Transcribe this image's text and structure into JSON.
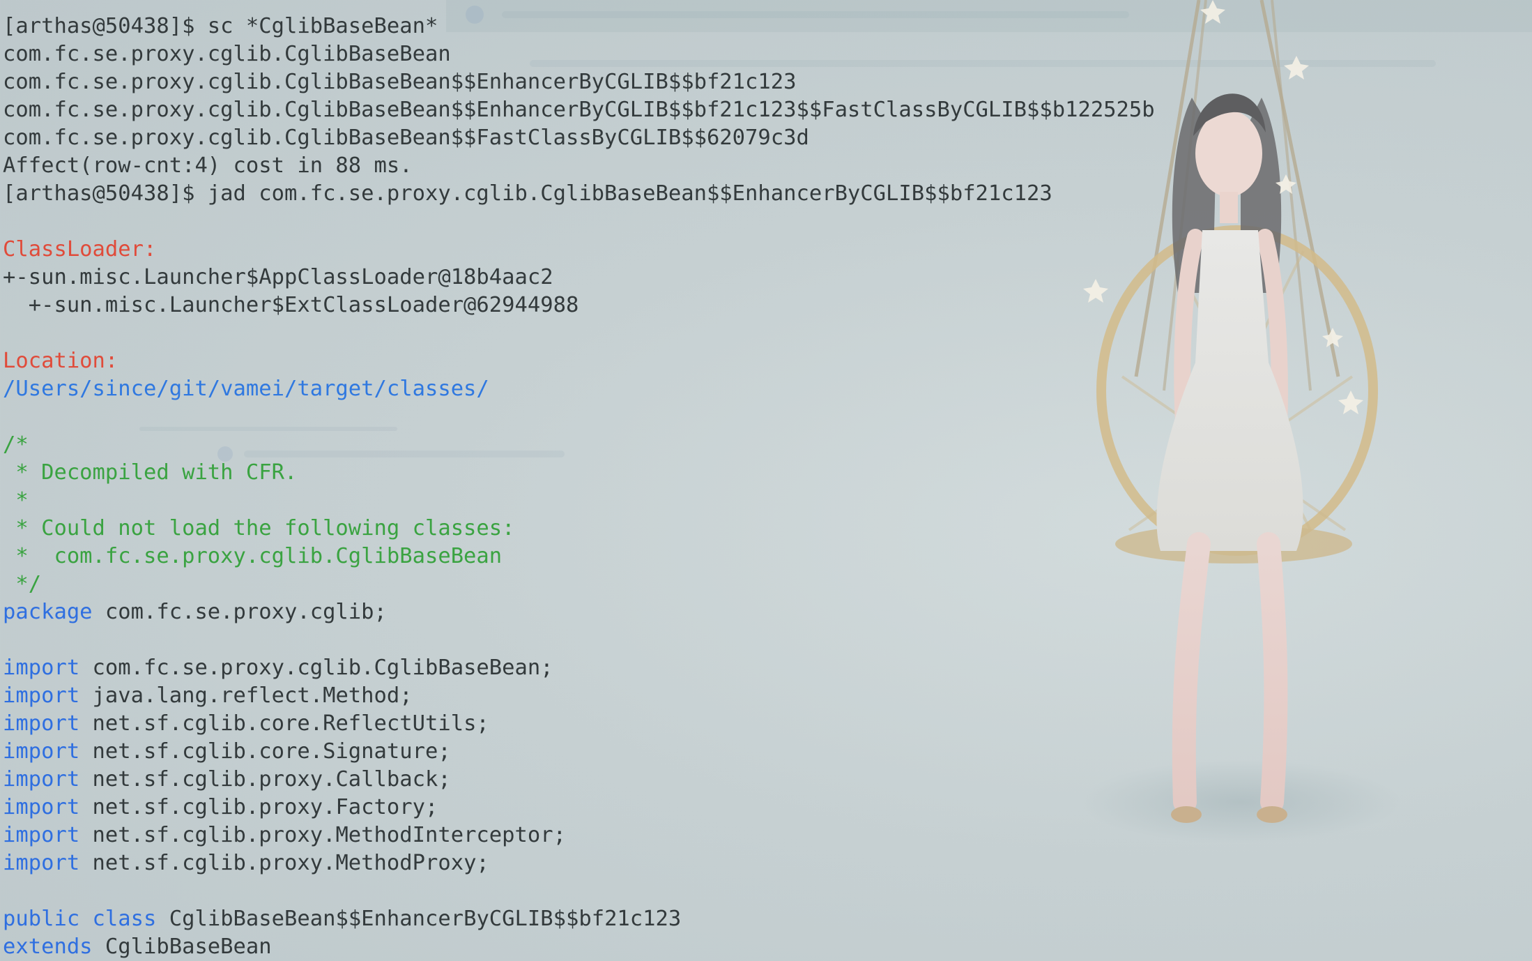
{
  "terminal": {
    "lines": [
      {
        "text": "[arthas@50438]$ sc *CglibBaseBean*"
      },
      {
        "text": "com.fc.se.proxy.cglib.CglibBaseBean"
      },
      {
        "text": "com.fc.se.proxy.cglib.CglibBaseBean$$EnhancerByCGLIB$$bf21c123"
      },
      {
        "text": "com.fc.se.proxy.cglib.CglibBaseBean$$EnhancerByCGLIB$$bf21c123$$FastClassByCGLIB$$b122525b"
      },
      {
        "text": "com.fc.se.proxy.cglib.CglibBaseBean$$FastClassByCGLIB$$62079c3d"
      },
      {
        "text": "Affect(row-cnt:4) cost in 88 ms."
      },
      {
        "text": "[arthas@50438]$ jad com.fc.se.proxy.cglib.CglibBaseBean$$EnhancerByCGLIB$$bf21c123"
      },
      {
        "text": ""
      },
      {
        "text": "ClassLoader:"
      },
      {
        "text": "+-sun.misc.Launcher$AppClassLoader@18b4aac2"
      },
      {
        "text": "  +-sun.misc.Launcher$ExtClassLoader@62944988"
      },
      {
        "text": ""
      },
      {
        "text": "Location:"
      },
      {
        "text": "/Users/since/git/vamei/target/classes/"
      },
      {
        "text": ""
      },
      {
        "text": "/*"
      },
      {
        "text": " * Decompiled with CFR."
      },
      {
        "text": " *"
      },
      {
        "text": " * Could not load the following classes:"
      },
      {
        "text": " *  com.fc.se.proxy.cglib.CglibBaseBean"
      },
      {
        "text": " */"
      },
      {
        "kw": "package",
        "text": " com.fc.se.proxy.cglib;"
      },
      {
        "text": ""
      },
      {
        "kw": "import",
        "text": " com.fc.se.proxy.cglib.CglibBaseBean;"
      },
      {
        "kw": "import",
        "text": " java.lang.reflect.Method;"
      },
      {
        "kw": "import",
        "text": " net.sf.cglib.core.ReflectUtils;"
      },
      {
        "kw": "import",
        "text": " net.sf.cglib.core.Signature;"
      },
      {
        "kw": "import",
        "text": " net.sf.cglib.proxy.Callback;"
      },
      {
        "kw": "import",
        "text": " net.sf.cglib.proxy.Factory;"
      },
      {
        "kw": "import",
        "text": " net.sf.cglib.proxy.MethodInterceptor;"
      },
      {
        "kw": "import",
        "text": " net.sf.cglib.proxy.MethodProxy;"
      },
      {
        "text": ""
      },
      {
        "kw": "public",
        "kw2": " class",
        "text": " CglibBaseBean$$EnhancerByCGLIB$$bf21c123"
      },
      {
        "kw": "extends",
        "text": " CglibBaseBean"
      }
    ]
  },
  "colors": {
    "text": "#333a3c",
    "label": "#e04b3a",
    "path": "#2f78e0",
    "comment": "#3aa341",
    "keyword": "#2f6fe0"
  }
}
